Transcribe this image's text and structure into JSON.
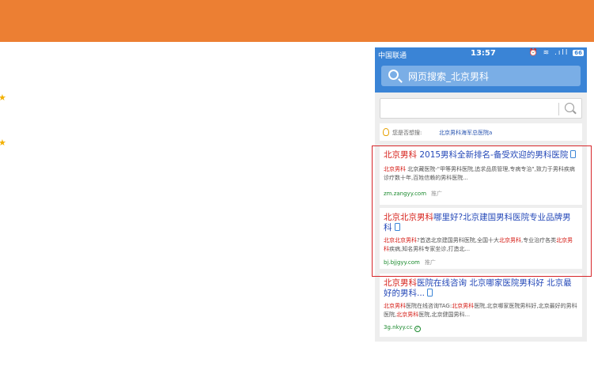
{
  "colors": {
    "banner": "#ec7f33",
    "phone_header": "#3a84d6",
    "link_title": "#2448b8",
    "keyword_highlight": "#d6201a",
    "url_green": "#1b8a2e",
    "frame_red": "#d6262a",
    "star": "#f3b000"
  },
  "status_bar": {
    "carrier": "中国联通",
    "time": "13:57",
    "icons": "⏰ ≋ .ıll",
    "battery": "66"
  },
  "header": {
    "search_text": "网页搜索_北京男科"
  },
  "search_box": {
    "icon": "search-icon"
  },
  "suggestion": {
    "prefix": "您是否想搜:",
    "link": "北京男科海军总医院a"
  },
  "results": [
    {
      "title_hl": "北京男科",
      "title_rest": " 2015男科全新排名-备受欢迎的男科医院",
      "desc_hl": "北京男科",
      "desc_rest": " 北京藏医院-\"甲等男科医院,追求品质管理,专病专治\",致力于男科疾病诊疗数十年,百姓信赖的男科医院...",
      "url": "zm.zangyy.com",
      "ad": "推广"
    },
    {
      "title_hl": "北京北京男科",
      "title_rest": "哪里好?北京建国男科医院专业品牌男科",
      "desc_hl1": "北京北京男科",
      "desc_mid1": "?首选北京建国男科医院,全国十大",
      "desc_hl2": "北京男科",
      "desc_mid2": ",专业治疗各类",
      "desc_hl3": "北京男科",
      "desc_mid3": "疾病,知名男科专家坐诊,打造北...",
      "url": "bj.bjjgyy.com",
      "ad": "推广"
    },
    {
      "title_hl": "北京男科",
      "title_rest": "医院在线咨询 北京哪家医院男科好 北京最好的男科...",
      "desc_hl1": "北京男科",
      "desc_mid1": "医院在线咨询TAG:",
      "desc_hl2": "北京男科",
      "desc_mid2": "医院,北京哪家医院男科好,北京最好的男科医院,",
      "desc_hl3": "北京男科",
      "desc_mid3": "医院,北京健国男科...",
      "url": "3g.nkyy.cc"
    }
  ]
}
